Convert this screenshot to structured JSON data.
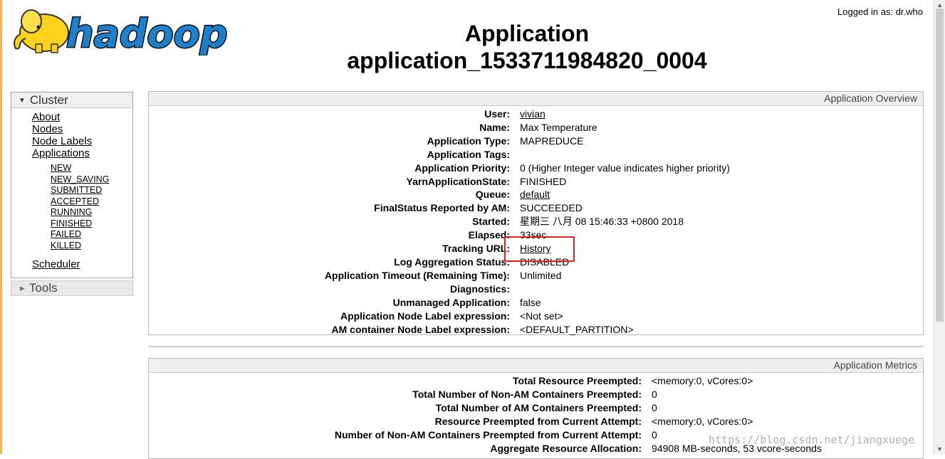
{
  "header": {
    "logo_text": "hadoop",
    "login_text": "Logged in as: dr.who",
    "title_line1": "Application",
    "title_line2": "application_1533711984820_0004"
  },
  "nav": {
    "cluster_label": "Cluster",
    "links": [
      "About",
      "Nodes",
      "Node Labels",
      "Applications"
    ],
    "app_states": [
      "NEW",
      "NEW_SAVING",
      "SUBMITTED",
      "ACCEPTED",
      "RUNNING",
      "FINISHED",
      "FAILED",
      "KILLED"
    ],
    "scheduler_label": "Scheduler",
    "tools_label": "Tools"
  },
  "overview": {
    "title": "Application Overview",
    "rows": [
      {
        "label": "User:",
        "value": "vivian",
        "link": true
      },
      {
        "label": "Name:",
        "value": "Max Temperature",
        "link": false
      },
      {
        "label": "Application Type:",
        "value": "MAPREDUCE",
        "link": false
      },
      {
        "label": "Application Tags:",
        "value": "",
        "link": false
      },
      {
        "label": "Application Priority:",
        "value": "0 (Higher Integer value indicates higher priority)",
        "link": false
      },
      {
        "label": "YarnApplicationState:",
        "value": "FINISHED",
        "link": false
      },
      {
        "label": "Queue:",
        "value": "default",
        "link": true
      },
      {
        "label": "FinalStatus Reported by AM:",
        "value": "SUCCEEDED",
        "link": false
      },
      {
        "label": "Started:",
        "value": "星期三 八月 08 15:46:33 +0800 2018",
        "link": false
      },
      {
        "label": "Elapsed:",
        "value": "33sec",
        "link": false
      },
      {
        "label": "Tracking URL:",
        "value": "History",
        "link": true
      },
      {
        "label": "Log Aggregation Status:",
        "value": "DISABLED",
        "link": false
      },
      {
        "label": "Application Timeout (Remaining Time):",
        "value": "Unlimited",
        "link": false
      },
      {
        "label": "Diagnostics:",
        "value": "",
        "link": false
      },
      {
        "label": "Unmanaged Application:",
        "value": "false",
        "link": false
      },
      {
        "label": "Application Node Label expression:",
        "value": "<Not set>",
        "link": false
      },
      {
        "label": "AM container Node Label expression:",
        "value": "<DEFAULT_PARTITION>",
        "link": false
      }
    ]
  },
  "metrics": {
    "title": "Application Metrics",
    "rows": [
      {
        "label": "Total Resource Preempted:",
        "value": "<memory:0, vCores:0>"
      },
      {
        "label": "Total Number of Non-AM Containers Preempted:",
        "value": "0"
      },
      {
        "label": "Total Number of AM Containers Preempted:",
        "value": "0"
      },
      {
        "label": "Resource Preempted from Current Attempt:",
        "value": "<memory:0, vCores:0>"
      },
      {
        "label": "Number of Non-AM Containers Preempted from Current Attempt:",
        "value": "0"
      },
      {
        "label": "Aggregate Resource Allocation:",
        "value": "94908 MB-seconds, 53 vcore-seconds"
      }
    ]
  },
  "watermark": "https://blog.csdn.net/jiangxuege",
  "colors": {
    "highlight": "#e02020",
    "logo_yellow": "#ffd21e",
    "logo_blue": "#1b6bb0"
  }
}
